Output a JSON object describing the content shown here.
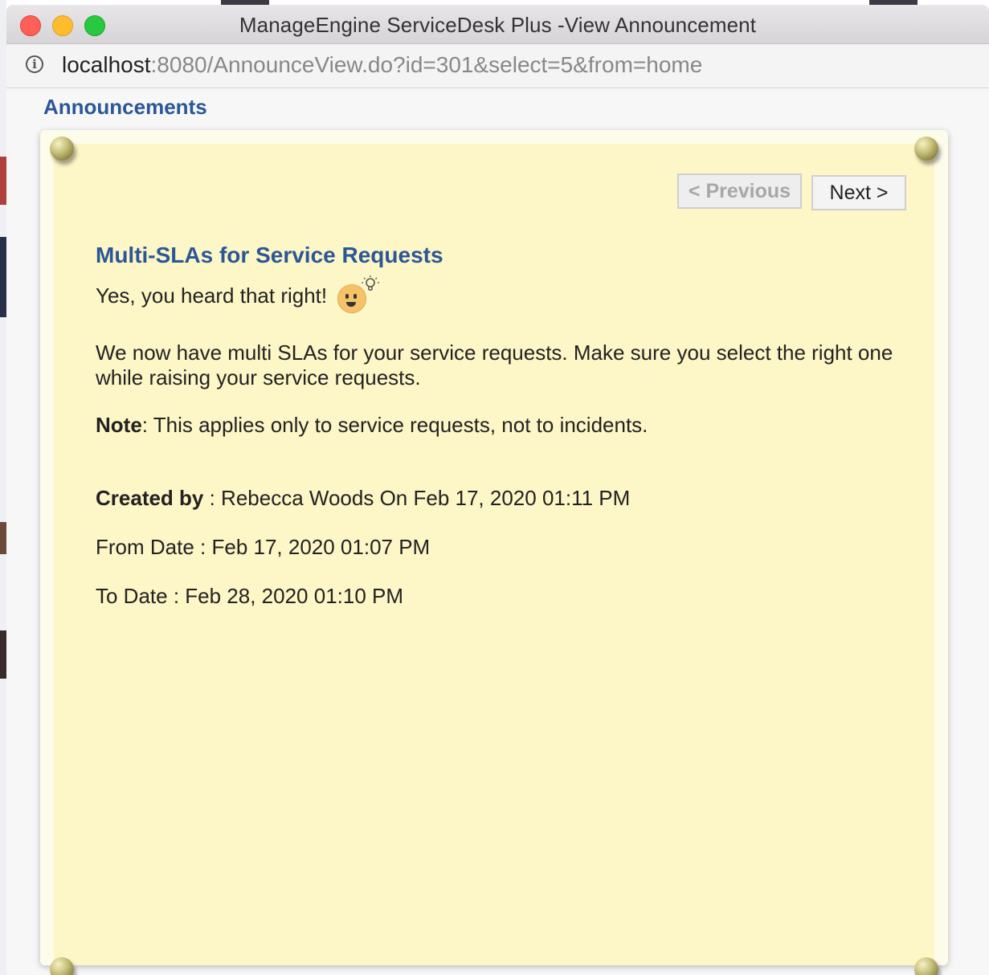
{
  "window": {
    "title": "ManageEngine ServiceDesk Plus -View Announcement"
  },
  "urlbar": {
    "host": "localhost",
    "path": ":8080/AnnounceView.do?id=301&select=5&from=home",
    "info_icon": "info-icon"
  },
  "page": {
    "heading": "Announcements"
  },
  "nav": {
    "previous_label": "< Previous",
    "next_label": "Next >"
  },
  "announcement": {
    "title": "Multi-SLAs for Service Requests",
    "intro": "Yes, you heard that right!",
    "emoji": "idea-face-emoji",
    "body": "We now have multi SLAs for your service requests. Make sure you select the right one while raising your service requests.",
    "note_label": "Note",
    "note_text": ": This applies only to service requests, not to incidents.",
    "created_by_label": "Created by",
    "created_by_value": " : Rebecca Woods On Feb 17, 2020 01:11 PM",
    "from_date": "From Date : Feb 17, 2020 01:07 PM",
    "to_date": "To Date : Feb 28, 2020 01:10 PM"
  },
  "colors": {
    "heading_blue": "#2b5797",
    "note_background": "#fdf6c6"
  }
}
